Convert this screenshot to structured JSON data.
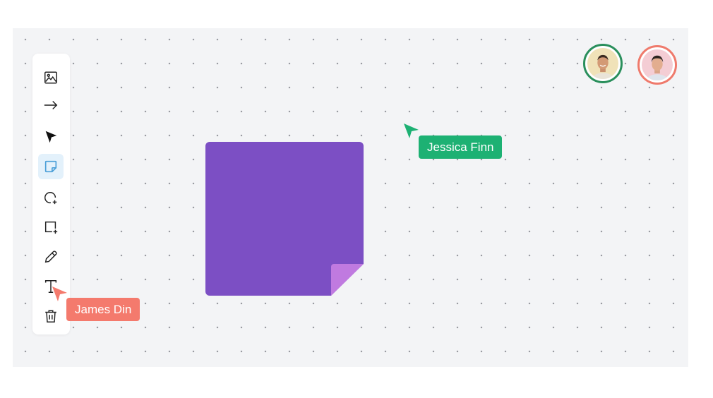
{
  "app": {
    "canvas_background": "#f3f4f6",
    "toolbar": {
      "tools": [
        {
          "name": "image",
          "icon": "image-icon",
          "active": false
        },
        {
          "name": "connector",
          "icon": "arrow-right-icon",
          "active": false
        },
        {
          "name": "select",
          "icon": "pointer-icon",
          "active": false
        },
        {
          "name": "sticky-note",
          "icon": "sticky-note-icon",
          "active": true
        },
        {
          "name": "add-circle",
          "icon": "circle-plus-icon",
          "active": false
        },
        {
          "name": "add-rectangle",
          "icon": "square-plus-icon",
          "active": false
        },
        {
          "name": "pencil",
          "icon": "pencil-icon",
          "active": false
        },
        {
          "name": "text",
          "icon": "text-icon",
          "active": false
        },
        {
          "name": "delete",
          "icon": "trash-icon",
          "active": false
        }
      ],
      "active_color": "#4a9fd8"
    },
    "sticky_note": {
      "color": "#7c4fc4",
      "fold_color": "#c07ae0"
    },
    "collaborators": [
      {
        "name": "Jessica Finn",
        "color": "#1db173",
        "ring_color": "#2a8f5c",
        "avatar_bg": "#f0e2b8"
      },
      {
        "name": "James Din",
        "color": "#f47a6d",
        "ring_color": "#ef7a6c",
        "avatar_bg": "#f4cdd4"
      }
    ],
    "cursors": {
      "jessica": {
        "label": "Jessica Finn",
        "color": "#1db173"
      },
      "james": {
        "label": "James Din",
        "color": "#f47a6d"
      }
    }
  }
}
